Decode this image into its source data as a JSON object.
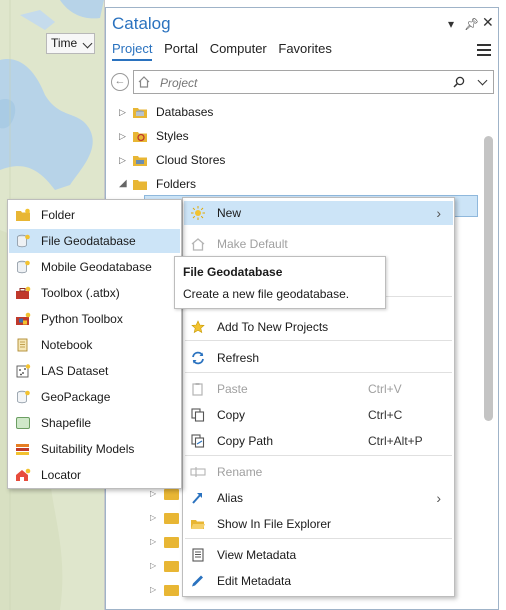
{
  "map": {
    "time_label": "Time"
  },
  "catalog": {
    "title": "Catalog",
    "tabs": [
      "Project",
      "Portal",
      "Computer",
      "Favorites"
    ],
    "search_placeholder": "Project",
    "tree": [
      {
        "label": "Databases"
      },
      {
        "label": "Styles"
      },
      {
        "label": "Cloud Stores"
      },
      {
        "label": "Folders"
      }
    ]
  },
  "context_menu": {
    "items": [
      {
        "label": "New",
        "mnemonic": "N"
      },
      {
        "label": "Make Default"
      },
      {
        "label": "Add To New Projects"
      },
      {
        "label": "Refresh"
      },
      {
        "label": "Paste",
        "shortcut": "Ctrl+V"
      },
      {
        "label": "Copy",
        "shortcut": "Ctrl+C"
      },
      {
        "label": "Copy Path",
        "shortcut": "Ctrl+Alt+P"
      },
      {
        "label": "Rename"
      },
      {
        "label": "Alias"
      },
      {
        "label": "Show In File Explorer"
      },
      {
        "label": "View Metadata"
      },
      {
        "label": "Edit Metadata"
      }
    ]
  },
  "submenu": {
    "items": [
      {
        "label": "Folder"
      },
      {
        "label": "File Geodatabase"
      },
      {
        "label": "Mobile Geodatabase"
      },
      {
        "label": "Toolbox (.atbx)"
      },
      {
        "label": "Python Toolbox"
      },
      {
        "label": "Notebook"
      },
      {
        "label": "LAS Dataset"
      },
      {
        "label": "GeoPackage"
      },
      {
        "label": "Shapefile"
      },
      {
        "label": "Suitability Models"
      },
      {
        "label": "Locator"
      }
    ]
  },
  "tooltip": {
    "title": "File Geodatabase",
    "description": "Create a new file geodatabase."
  },
  "colors": {
    "accent": "#2a72bf",
    "highlight": "#cce4f7",
    "folder": "#e8b634"
  }
}
